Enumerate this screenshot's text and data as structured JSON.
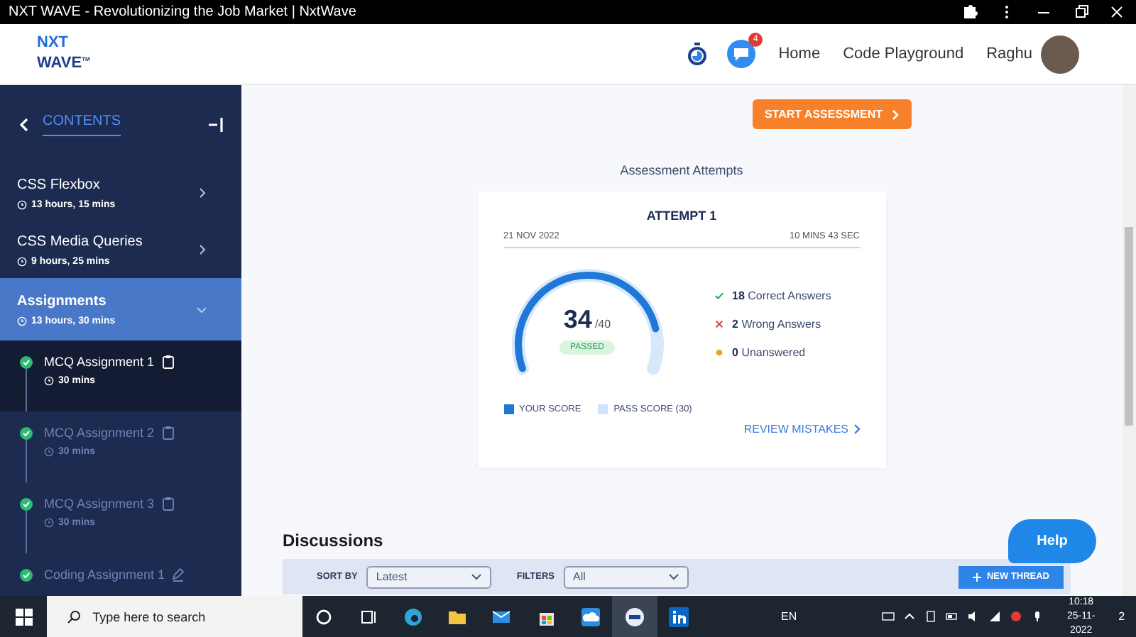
{
  "window": {
    "title": "NXT WAVE - Revolutionizing the Job Market | NxtWave"
  },
  "header": {
    "logo_line1": "NXT",
    "logo_line2": "WAVE",
    "logo_mark": "TM",
    "notification_count": "4",
    "nav": [
      "Home",
      "Code Playground"
    ],
    "user": "Raghu"
  },
  "sidebar": {
    "title": "CONTENTS",
    "sections": [
      {
        "title": "CSS Flexbox",
        "duration": "13 hours, 15 mins",
        "expanded": false
      },
      {
        "title": "CSS Media Queries",
        "duration": "9 hours, 25 mins",
        "expanded": false
      },
      {
        "title": "Assignments",
        "duration": "13 hours, 30 mins",
        "expanded": true,
        "children": [
          {
            "kind": "mcq",
            "title": "MCQ Assignment 1",
            "duration": "30 mins",
            "selected": true,
            "done": true
          },
          {
            "kind": "mcq",
            "title": "MCQ Assignment 2",
            "duration": "30 mins",
            "selected": false,
            "done": true
          },
          {
            "kind": "mcq",
            "title": "MCQ Assignment 3",
            "duration": "30 mins",
            "selected": false,
            "done": true
          },
          {
            "kind": "coding",
            "title": "Coding Assignment 1",
            "selected": false,
            "done": true
          }
        ]
      }
    ]
  },
  "start_button": "START ASSESSMENT",
  "attempts_title": "Assessment Attempts",
  "attempt": {
    "title": "ATTEMPT 1",
    "date": "21 NOV 2022",
    "time": "10 MINS 43 SEC",
    "score": "34",
    "total": "/40",
    "status": "PASSED",
    "stats": [
      {
        "kind": "correct",
        "count": "18",
        "label": "Correct Answers"
      },
      {
        "kind": "wrong",
        "count": "2",
        "label": "Wrong Answers"
      },
      {
        "kind": "unanswered",
        "count": "0",
        "label": "Unanswered"
      }
    ],
    "legend": [
      "YOUR SCORE",
      "PASS SCORE (30)"
    ],
    "review": "REVIEW MISTAKES"
  },
  "discussions": {
    "title": "Discussions",
    "sort_label": "SORT BY",
    "sort_value": "Latest",
    "filter_label": "FILTERS",
    "filter_value": "All",
    "new_thread": "NEW THREAD"
  },
  "help": "Help",
  "taskbar": {
    "search_placeholder": "Type here to search",
    "language": "EN",
    "time": "10:18",
    "date": "25-11-2022",
    "notifications": "2"
  }
}
